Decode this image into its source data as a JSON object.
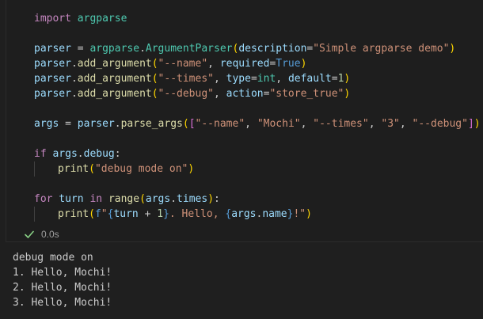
{
  "cell": {
    "code_lines": [
      [
        {
          "t": "import",
          "c": "kw-purple"
        },
        {
          "t": " argparse",
          "c": "cls"
        }
      ],
      [],
      [
        {
          "t": "parser",
          "c": "var"
        },
        {
          "t": " = ",
          "c": "punc"
        },
        {
          "t": "argparse",
          "c": "cls"
        },
        {
          "t": ".",
          "c": "punc"
        },
        {
          "t": "ArgumentParser",
          "c": "cls"
        },
        {
          "t": "(",
          "c": "bracket1"
        },
        {
          "t": "description",
          "c": "param"
        },
        {
          "t": "=",
          "c": "punc"
        },
        {
          "t": "\"Simple argparse demo\"",
          "c": "str"
        },
        {
          "t": ")",
          "c": "bracket1"
        }
      ],
      [
        {
          "t": "parser",
          "c": "var"
        },
        {
          "t": ".",
          "c": "punc"
        },
        {
          "t": "add_argument",
          "c": "fn"
        },
        {
          "t": "(",
          "c": "bracket1"
        },
        {
          "t": "\"--name\"",
          "c": "str"
        },
        {
          "t": ", ",
          "c": "punc"
        },
        {
          "t": "required",
          "c": "param"
        },
        {
          "t": "=",
          "c": "punc"
        },
        {
          "t": "True",
          "c": "kw-blue"
        },
        {
          "t": ")",
          "c": "bracket1"
        }
      ],
      [
        {
          "t": "parser",
          "c": "var"
        },
        {
          "t": ".",
          "c": "punc"
        },
        {
          "t": "add_argument",
          "c": "fn"
        },
        {
          "t": "(",
          "c": "bracket1"
        },
        {
          "t": "\"--times\"",
          "c": "str"
        },
        {
          "t": ", ",
          "c": "punc"
        },
        {
          "t": "type",
          "c": "param"
        },
        {
          "t": "=",
          "c": "punc"
        },
        {
          "t": "int",
          "c": "cls"
        },
        {
          "t": ", ",
          "c": "punc"
        },
        {
          "t": "default",
          "c": "param"
        },
        {
          "t": "=",
          "c": "punc"
        },
        {
          "t": "1",
          "c": "num"
        },
        {
          "t": ")",
          "c": "bracket1"
        }
      ],
      [
        {
          "t": "parser",
          "c": "var"
        },
        {
          "t": ".",
          "c": "punc"
        },
        {
          "t": "add_argument",
          "c": "fn"
        },
        {
          "t": "(",
          "c": "bracket1"
        },
        {
          "t": "\"--debug\"",
          "c": "str"
        },
        {
          "t": ", ",
          "c": "punc"
        },
        {
          "t": "action",
          "c": "param"
        },
        {
          "t": "=",
          "c": "punc"
        },
        {
          "t": "\"store_true\"",
          "c": "str"
        },
        {
          "t": ")",
          "c": "bracket1"
        }
      ],
      [],
      [
        {
          "t": "args",
          "c": "var"
        },
        {
          "t": " = ",
          "c": "punc"
        },
        {
          "t": "parser",
          "c": "var"
        },
        {
          "t": ".",
          "c": "punc"
        },
        {
          "t": "parse_args",
          "c": "fn"
        },
        {
          "t": "(",
          "c": "bracket1"
        },
        {
          "t": "[",
          "c": "bracket2"
        },
        {
          "t": "\"--name\"",
          "c": "str"
        },
        {
          "t": ", ",
          "c": "punc"
        },
        {
          "t": "\"Mochi\"",
          "c": "str"
        },
        {
          "t": ", ",
          "c": "punc"
        },
        {
          "t": "\"--times\"",
          "c": "str"
        },
        {
          "t": ", ",
          "c": "punc"
        },
        {
          "t": "\"3\"",
          "c": "str"
        },
        {
          "t": ", ",
          "c": "punc"
        },
        {
          "t": "\"--debug\"",
          "c": "str"
        },
        {
          "t": "]",
          "c": "bracket2"
        },
        {
          "t": ")",
          "c": "bracket1"
        }
      ],
      [],
      [
        {
          "t": "if",
          "c": "kw-purple"
        },
        {
          "t": " args",
          "c": "var"
        },
        {
          "t": ".",
          "c": "punc"
        },
        {
          "t": "debug",
          "c": "var"
        },
        {
          "t": ":",
          "c": "punc"
        }
      ],
      [
        {
          "indent": 1
        },
        {
          "t": "print",
          "c": "fn"
        },
        {
          "t": "(",
          "c": "bracket1"
        },
        {
          "t": "\"debug mode on\"",
          "c": "str"
        },
        {
          "t": ")",
          "c": "bracket1"
        }
      ],
      [],
      [
        {
          "t": "for",
          "c": "kw-purple"
        },
        {
          "t": " turn",
          "c": "var"
        },
        {
          "t": " in",
          "c": "kw-purple"
        },
        {
          "t": " ",
          "c": "punc"
        },
        {
          "t": "range",
          "c": "fn"
        },
        {
          "t": "(",
          "c": "bracket1"
        },
        {
          "t": "args",
          "c": "var"
        },
        {
          "t": ".",
          "c": "punc"
        },
        {
          "t": "times",
          "c": "var"
        },
        {
          "t": ")",
          "c": "bracket1"
        },
        {
          "t": ":",
          "c": "punc"
        }
      ],
      [
        {
          "indent": 1
        },
        {
          "t": "print",
          "c": "fn"
        },
        {
          "t": "(",
          "c": "bracket1"
        },
        {
          "t": "f",
          "c": "kw-blue"
        },
        {
          "t": "\"",
          "c": "str"
        },
        {
          "t": "{",
          "c": "kw-blue"
        },
        {
          "t": "turn",
          "c": "var"
        },
        {
          "t": " + ",
          "c": "punc"
        },
        {
          "t": "1",
          "c": "num"
        },
        {
          "t": "}",
          "c": "kw-blue"
        },
        {
          "t": ". Hello, ",
          "c": "str"
        },
        {
          "t": "{",
          "c": "kw-blue"
        },
        {
          "t": "args",
          "c": "var"
        },
        {
          "t": ".",
          "c": "punc"
        },
        {
          "t": "name",
          "c": "var"
        },
        {
          "t": "}",
          "c": "kw-blue"
        },
        {
          "t": "!\"",
          "c": "str"
        },
        {
          "t": ")",
          "c": "bracket1"
        }
      ]
    ],
    "status": {
      "check_icon": "check-icon",
      "duration": "0.0s",
      "color_success": "#89d185"
    }
  },
  "output_lines": [
    "debug mode on",
    "1. Hello, Mochi!",
    "2. Hello, Mochi!",
    "3. Hello, Mochi!"
  ]
}
